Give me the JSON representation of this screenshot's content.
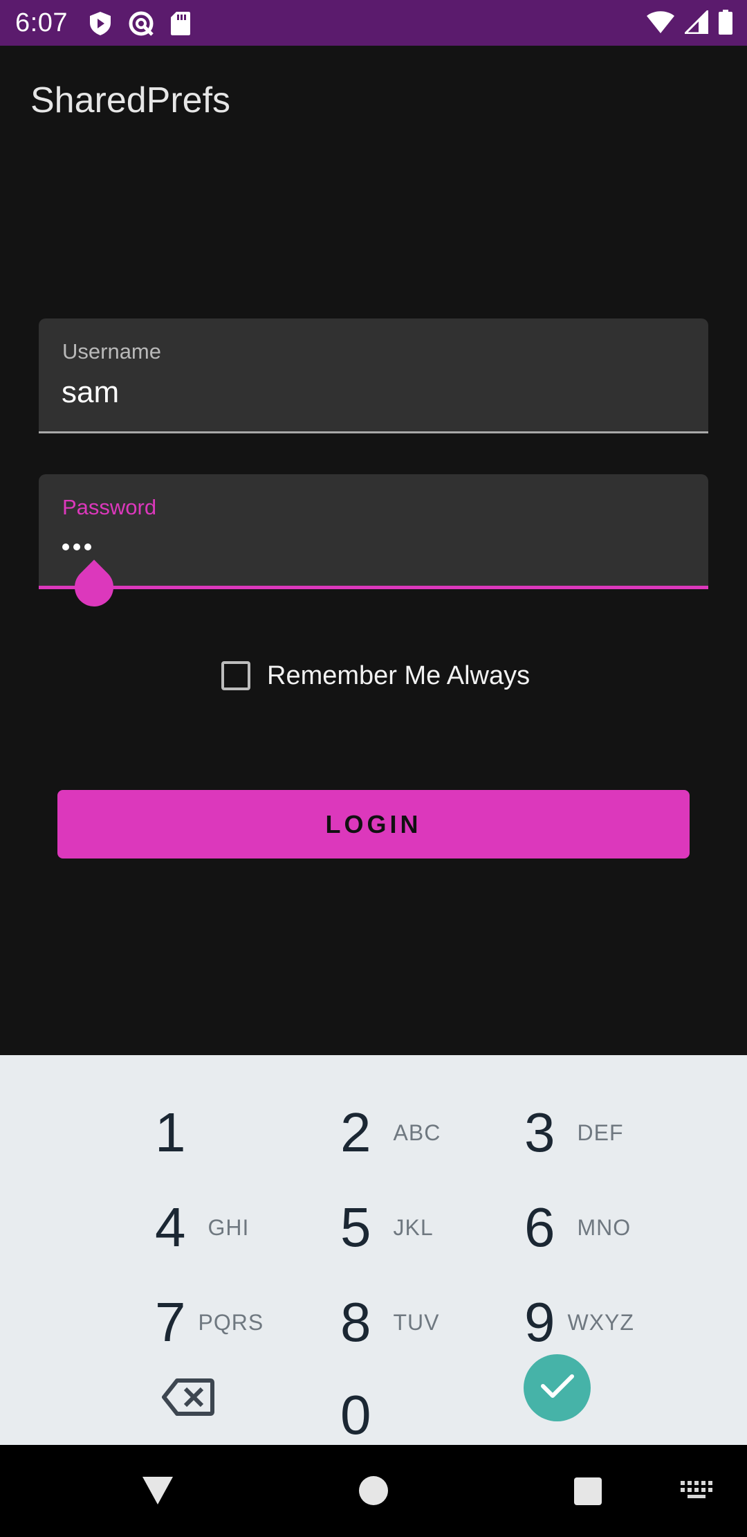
{
  "status_bar": {
    "time": "6:07",
    "left_icons": [
      "play-protect-icon",
      "data-saver-icon",
      "sd-card-icon"
    ],
    "right_icons": [
      "wifi-icon",
      "cell-signal-icon",
      "battery-icon"
    ],
    "color": "#5b1b6d"
  },
  "app_bar": {
    "title": "SharedPrefs"
  },
  "form": {
    "username": {
      "label": "Username",
      "value": "sam"
    },
    "password": {
      "label": "Password",
      "value_masked": "•••",
      "focused": true
    },
    "remember": {
      "label": "Remember Me Always",
      "checked": false
    },
    "login_button_label": "LOGIN"
  },
  "keypad": {
    "keys": [
      {
        "digit": "1",
        "letters": ""
      },
      {
        "digit": "2",
        "letters": "ABC"
      },
      {
        "digit": "3",
        "letters": "DEF"
      },
      {
        "digit": "4",
        "letters": "GHI"
      },
      {
        "digit": "5",
        "letters": "JKL"
      },
      {
        "digit": "6",
        "letters": "MNO"
      },
      {
        "digit": "7",
        "letters": "PQRS"
      },
      {
        "digit": "8",
        "letters": "TUV"
      },
      {
        "digit": "9",
        "letters": "WXYZ"
      },
      {
        "digit": "0",
        "letters": ""
      }
    ],
    "backspace_icon": "backspace-icon",
    "done_icon": "check-icon"
  },
  "nav_bar": {
    "icons": [
      "back-icon",
      "home-icon",
      "recents-icon",
      "keyboard-icon"
    ]
  },
  "colors": {
    "accent": "#dc38bc",
    "background": "#131313",
    "field_bg": "#313131",
    "keypad_bg": "#e8ecef",
    "done_key": "#46b3a8"
  }
}
